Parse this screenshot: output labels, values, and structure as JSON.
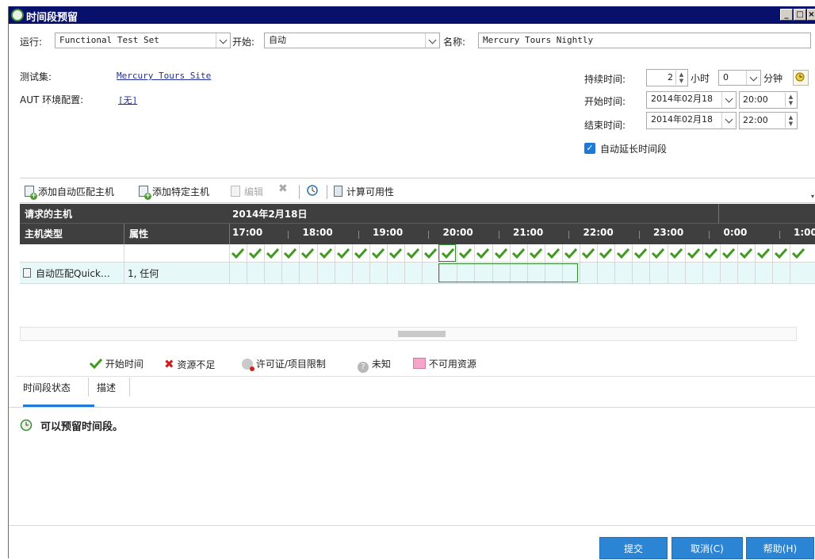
{
  "window": {
    "title": "时间段预留"
  },
  "form": {
    "run_label": "运行:",
    "run_value": "Functional Test Set",
    "start_label": "开始:",
    "start_value": "自动",
    "name_label": "名称:",
    "name_value": "Mercury Tours Nightly",
    "testset_label": "测试集:",
    "testset_link": "Mercury Tours Site",
    "aut_label": "AUT 环境配置:",
    "aut_link": "[无]",
    "duration_label": "持续时间:",
    "duration_hours": "2",
    "hours_unit": "小时",
    "duration_minutes": "0",
    "minutes_unit": "分钟",
    "start_time_label": "开始时间:",
    "start_date": "2014年02月18",
    "start_time": "20:00",
    "end_time_label": "结束时间:",
    "end_date": "2014年02月18",
    "end_time": "22:00",
    "auto_extend_label": "自动延长时间段",
    "auto_extend_checked": true
  },
  "toolbar": {
    "add_auto_host": "添加自动匹配主机",
    "add_specific_host": "添加特定主机",
    "edit": "编辑",
    "calc_availability": "计算可用性"
  },
  "grid": {
    "header_requested": "请求的主机",
    "header_date": "2014年2月18日",
    "col_host_type": "主机类型",
    "col_attributes": "属性",
    "hours": [
      "17:00",
      "18:00",
      "19:00",
      "20:00",
      "21:00",
      "22:00",
      "23:00",
      "0:00",
      "1:00"
    ],
    "rows": [
      {
        "host_type": "自动匹配Quick…",
        "attributes": "1, 任何"
      }
    ]
  },
  "legend": {
    "start_time": "开始时间",
    "insufficient": "资源不足",
    "license_limit": "许可证/项目限制",
    "unknown": "未知",
    "unavailable": "不可用资源"
  },
  "tabs": {
    "status": "时间段状态",
    "description": "描述"
  },
  "status": {
    "message": "可以预留时间段。"
  },
  "buttons": {
    "submit": "提交",
    "cancel": "取消(C)",
    "help": "帮助(H)"
  },
  "colors": {
    "titlebar": "#07106b",
    "header_bg": "#3f3f3f",
    "row_highlight": "#e6f8f8",
    "check_green": "#3f9a1f",
    "selection_green": "#2f8f2f",
    "button_blue": "#2b84d4",
    "cross_red": "#d21f1f",
    "unavailable_pink": "#f3a6c8"
  }
}
